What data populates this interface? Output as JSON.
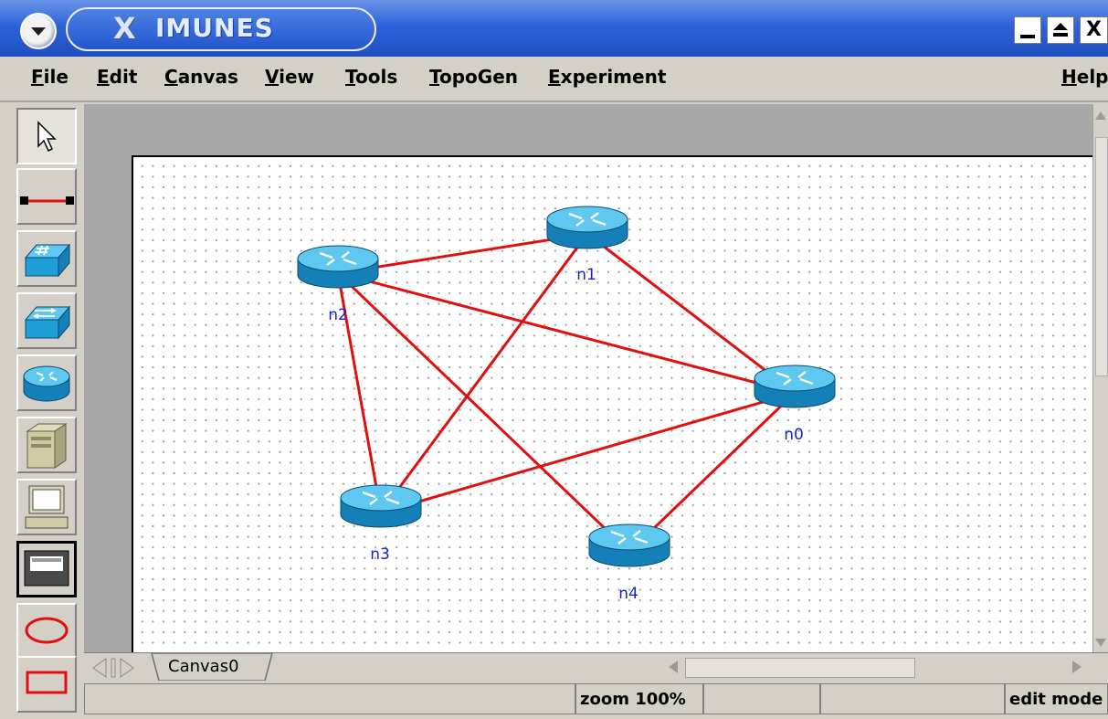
{
  "window": {
    "title": "IMUNES",
    "title_icon": "X",
    "controls": {
      "close_glyph": "X"
    }
  },
  "menu": [
    {
      "label": "File",
      "name": "menu-file"
    },
    {
      "label": "Edit",
      "name": "menu-edit"
    },
    {
      "label": "Canvas",
      "name": "menu-canvas"
    },
    {
      "label": "View",
      "name": "menu-view"
    },
    {
      "label": "Tools",
      "name": "menu-tools"
    },
    {
      "label": "TopoGen",
      "name": "menu-topogen"
    },
    {
      "label": "Experiment",
      "name": "menu-experiment"
    },
    {
      "label": "Help",
      "name": "menu-help"
    }
  ],
  "toolbar": [
    {
      "icon": "select-arrow-icon",
      "active": true
    },
    {
      "icon": "link-tool-icon"
    },
    {
      "icon": "hub-icon"
    },
    {
      "icon": "lan-switch-icon"
    },
    {
      "icon": "router-icon"
    },
    {
      "icon": "host-icon"
    },
    {
      "icon": "pc-icon"
    },
    {
      "icon": "physical-interface-icon"
    },
    {
      "icon": "oval-tool-icon"
    },
    {
      "icon": "rectangle-tool-icon"
    }
  ],
  "topology": {
    "nodes": [
      {
        "id": "n0",
        "label": "n0",
        "type": "router"
      },
      {
        "id": "n1",
        "label": "n1",
        "type": "router"
      },
      {
        "id": "n2",
        "label": "n2",
        "type": "router"
      },
      {
        "id": "n3",
        "label": "n3",
        "type": "router"
      },
      {
        "id": "n4",
        "label": "n4",
        "type": "router"
      }
    ],
    "links": [
      [
        "n2",
        "n1"
      ],
      [
        "n2",
        "n0"
      ],
      [
        "n2",
        "n3"
      ],
      [
        "n2",
        "n4"
      ],
      [
        "n1",
        "n0"
      ],
      [
        "n1",
        "n3"
      ],
      [
        "n0",
        "n3"
      ],
      [
        "n0",
        "n4"
      ]
    ],
    "link_color": "#e01010"
  },
  "tabs": [
    {
      "label": "Canvas0",
      "selected": true
    }
  ],
  "status": {
    "zoom": "zoom 100%",
    "mode": "edit mode"
  },
  "colors": {
    "titlebar": "#2d62d8",
    "router_body": "#1e9fd8",
    "node_label": "#1a20c8"
  }
}
